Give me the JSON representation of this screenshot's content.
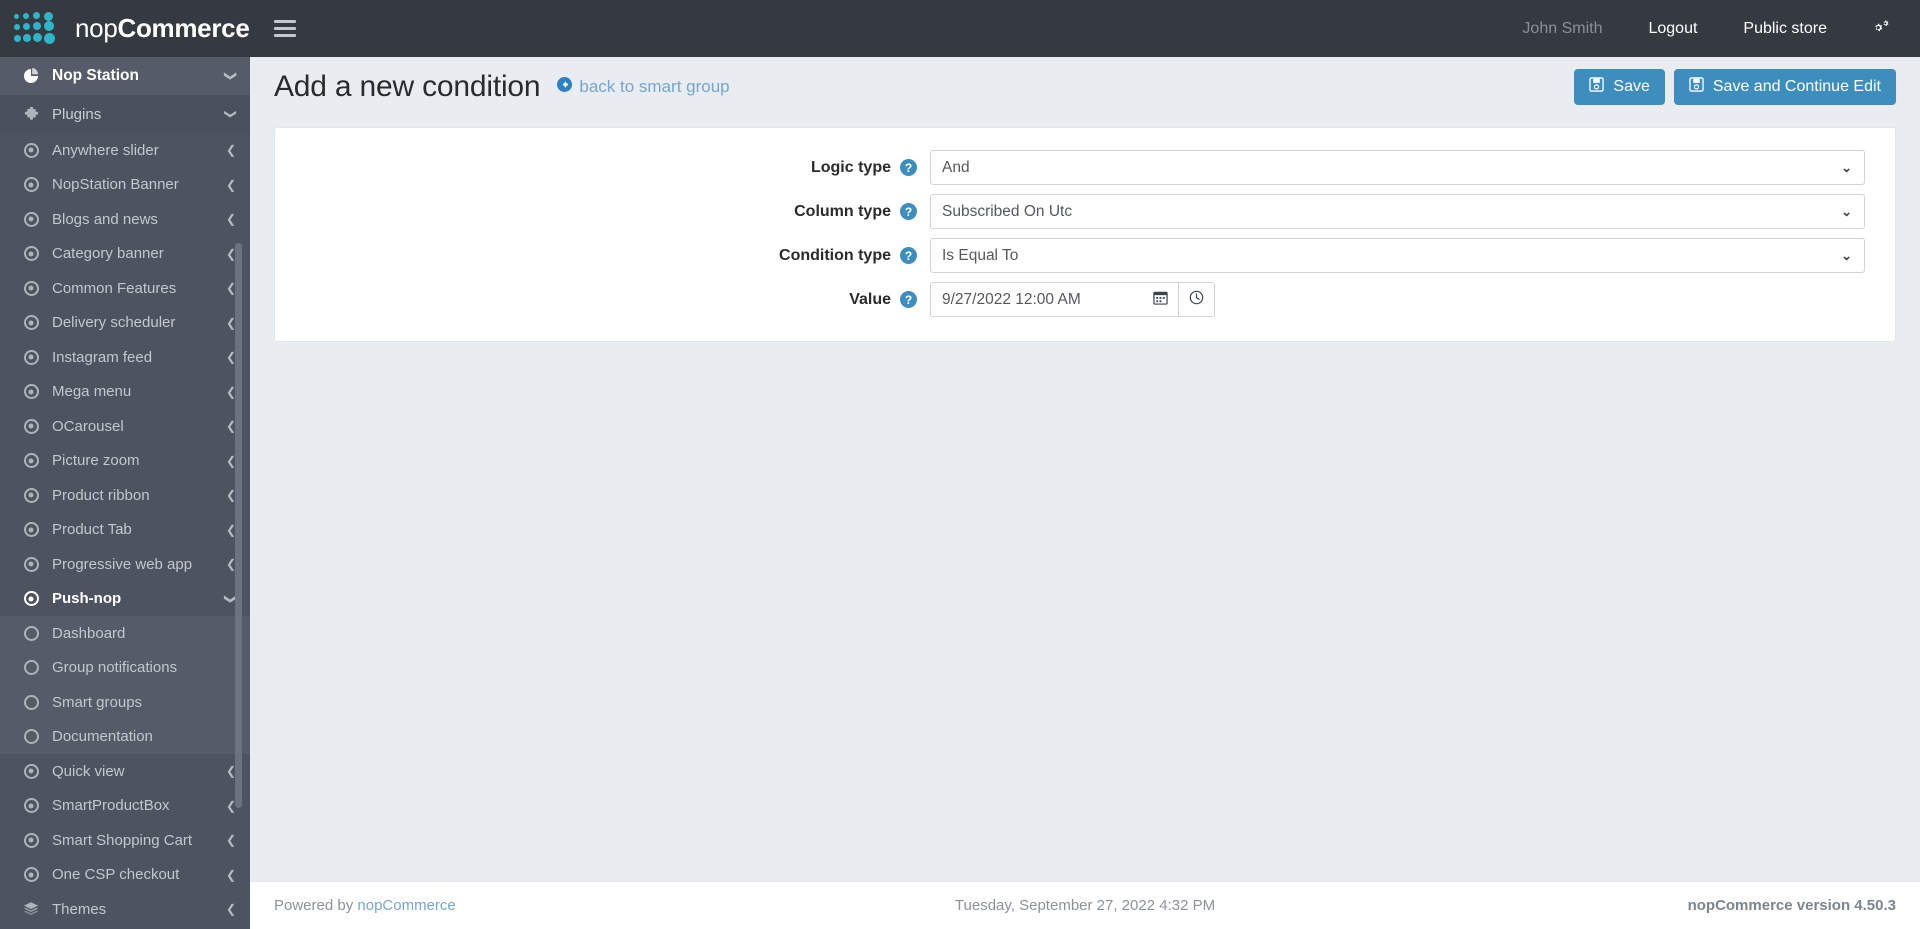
{
  "brand": {
    "name_light": "nop",
    "name_bold": "Commerce",
    "logo_color": "#2fb5c9"
  },
  "topbar": {
    "hamburger": "menu-icon",
    "user_name": "John Smith",
    "logout": "Logout",
    "public_store": "Public store",
    "gear": "gears-icon"
  },
  "sidebar": {
    "items": [
      {
        "label": "Nop Station",
        "icon": "pie-chart-icon",
        "chevron": "down",
        "style": "header"
      },
      {
        "label": "Plugins",
        "icon": "puzzle-icon",
        "chevron": "down",
        "style": "plugins"
      },
      {
        "label": "Anywhere slider",
        "icon": "dot-circle-icon",
        "chevron": "left",
        "style": "normal"
      },
      {
        "label": "NopStation Banner",
        "icon": "dot-circle-icon",
        "chevron": "left",
        "style": "normal"
      },
      {
        "label": "Blogs and news",
        "icon": "dot-circle-icon",
        "chevron": "left",
        "style": "normal"
      },
      {
        "label": "Category banner",
        "icon": "dot-circle-icon",
        "chevron": "left",
        "style": "normal"
      },
      {
        "label": "Common Features",
        "icon": "dot-circle-icon",
        "chevron": "left",
        "style": "normal"
      },
      {
        "label": "Delivery scheduler",
        "icon": "dot-circle-icon",
        "chevron": "left",
        "style": "normal"
      },
      {
        "label": "Instagram feed",
        "icon": "dot-circle-icon",
        "chevron": "left",
        "style": "normal"
      },
      {
        "label": "Mega menu",
        "icon": "dot-circle-icon",
        "chevron": "left",
        "style": "normal"
      },
      {
        "label": "OCarousel",
        "icon": "dot-circle-icon",
        "chevron": "left",
        "style": "normal"
      },
      {
        "label": "Picture zoom",
        "icon": "dot-circle-icon",
        "chevron": "left",
        "style": "normal"
      },
      {
        "label": "Product ribbon",
        "icon": "dot-circle-icon",
        "chevron": "left",
        "style": "normal"
      },
      {
        "label": "Product Tab",
        "icon": "dot-circle-icon",
        "chevron": "left",
        "style": "normal"
      },
      {
        "label": "Progressive web app",
        "icon": "dot-circle-icon",
        "chevron": "left",
        "style": "normal"
      },
      {
        "label": "Push-nop",
        "icon": "dot-circle-icon",
        "chevron": "down",
        "style": "active"
      },
      {
        "label": "Dashboard",
        "icon": "circle-icon",
        "chevron": "",
        "style": "sub"
      },
      {
        "label": "Group notifications",
        "icon": "circle-icon",
        "chevron": "",
        "style": "sub"
      },
      {
        "label": "Smart groups",
        "icon": "circle-icon",
        "chevron": "",
        "style": "sub"
      },
      {
        "label": "Documentation",
        "icon": "circle-icon",
        "chevron": "",
        "style": "sub"
      },
      {
        "label": "Quick view",
        "icon": "dot-circle-icon",
        "chevron": "left",
        "style": "normal"
      },
      {
        "label": "SmartProductBox",
        "icon": "dot-circle-icon",
        "chevron": "left",
        "style": "normal"
      },
      {
        "label": "Smart Shopping Cart",
        "icon": "dot-circle-icon",
        "chevron": "left",
        "style": "normal"
      },
      {
        "label": "One CSP checkout",
        "icon": "dot-circle-icon",
        "chevron": "left",
        "style": "normal"
      },
      {
        "label": "Themes",
        "icon": "layers-icon",
        "chevron": "left",
        "style": "normal"
      }
    ]
  },
  "page": {
    "title": "Add a new condition",
    "back_link": "back to smart group",
    "back_icon": "arrow-circle-left-icon",
    "save_label": "Save",
    "save_continue_label": "Save and Continue Edit",
    "save_icon": "floppy-disk-icon",
    "accent_color": "#3e8ebd"
  },
  "form": {
    "fields": [
      {
        "label": "Logic type",
        "value": "And",
        "control": "select"
      },
      {
        "label": "Column type",
        "value": "Subscribed On Utc",
        "control": "select"
      },
      {
        "label": "Condition type",
        "value": "Is Equal To",
        "control": "select"
      }
    ],
    "value_field": {
      "label": "Value",
      "value": "9/27/2022 12:00 AM",
      "placeholder": "",
      "calendar_icon": "calendar-icon",
      "clock_icon": "clock-icon"
    },
    "help_icon": "question-circle-icon"
  },
  "footer": {
    "powered_by": "Powered by",
    "powered_by_link": "nopCommerce",
    "datetime": "Tuesday, September 27, 2022 4:32 PM",
    "version": "nopCommerce version 4.50.3"
  }
}
